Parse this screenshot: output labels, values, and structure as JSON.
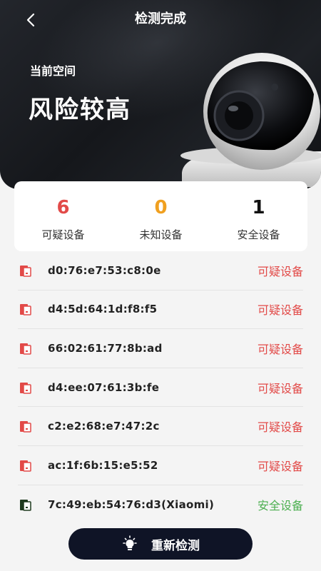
{
  "header": {
    "title": "检测完成",
    "space_label": "当前空间",
    "risk_level": "风险较高"
  },
  "stats": [
    {
      "value": "6",
      "label": "可疑设备",
      "color": "#e24a48"
    },
    {
      "value": "0",
      "label": "未知设备",
      "color": "#f0a020"
    },
    {
      "value": "1",
      "label": "安全设备",
      "color": "#111111"
    }
  ],
  "devices": [
    {
      "mac": "d0:76:e7:53:c8:0e",
      "status": "可疑设备",
      "kind": "suspicious"
    },
    {
      "mac": "d4:5d:64:1d:f8:f5",
      "status": "可疑设备",
      "kind": "suspicious"
    },
    {
      "mac": "66:02:61:77:8b:ad",
      "status": "可疑设备",
      "kind": "suspicious"
    },
    {
      "mac": "d4:ee:07:61:3b:fe",
      "status": "可疑设备",
      "kind": "suspicious"
    },
    {
      "mac": "c2:e2:68:e7:47:2c",
      "status": "可疑设备",
      "kind": "suspicious"
    },
    {
      "mac": "ac:1f:6b:15:e5:52",
      "status": "可疑设备",
      "kind": "suspicious"
    },
    {
      "mac": "7c:49:eb:54:76:d3(Xiaomi)",
      "status": "安全设备",
      "kind": "safe"
    }
  ],
  "colors": {
    "suspicious": "#e24a48",
    "safe": "#4caf50",
    "button_bg": "#0f1426"
  },
  "icons": {
    "back": "chevron-left-icon",
    "device_suspicious": "device-icon",
    "device_safe": "device-icon",
    "rescan": "lightbulb-icon"
  },
  "rescan_label": "重新检测"
}
